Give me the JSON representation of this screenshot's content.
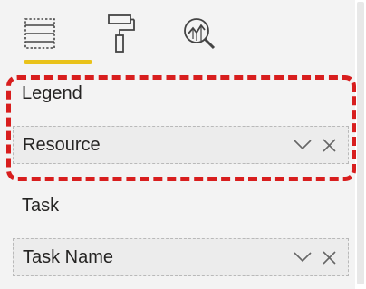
{
  "tabs": [
    {
      "name": "fields",
      "icon": "fields-icon"
    },
    {
      "name": "format",
      "icon": "paint-roller-icon"
    },
    {
      "name": "analytics",
      "icon": "analytics-icon"
    }
  ],
  "active_tab": "fields",
  "accent_color": "#e9c21a",
  "highlight_color": "#d81e1e",
  "wells": [
    {
      "label": "Legend",
      "field": "Resource"
    },
    {
      "label": "Task",
      "field": "Task Name"
    }
  ]
}
